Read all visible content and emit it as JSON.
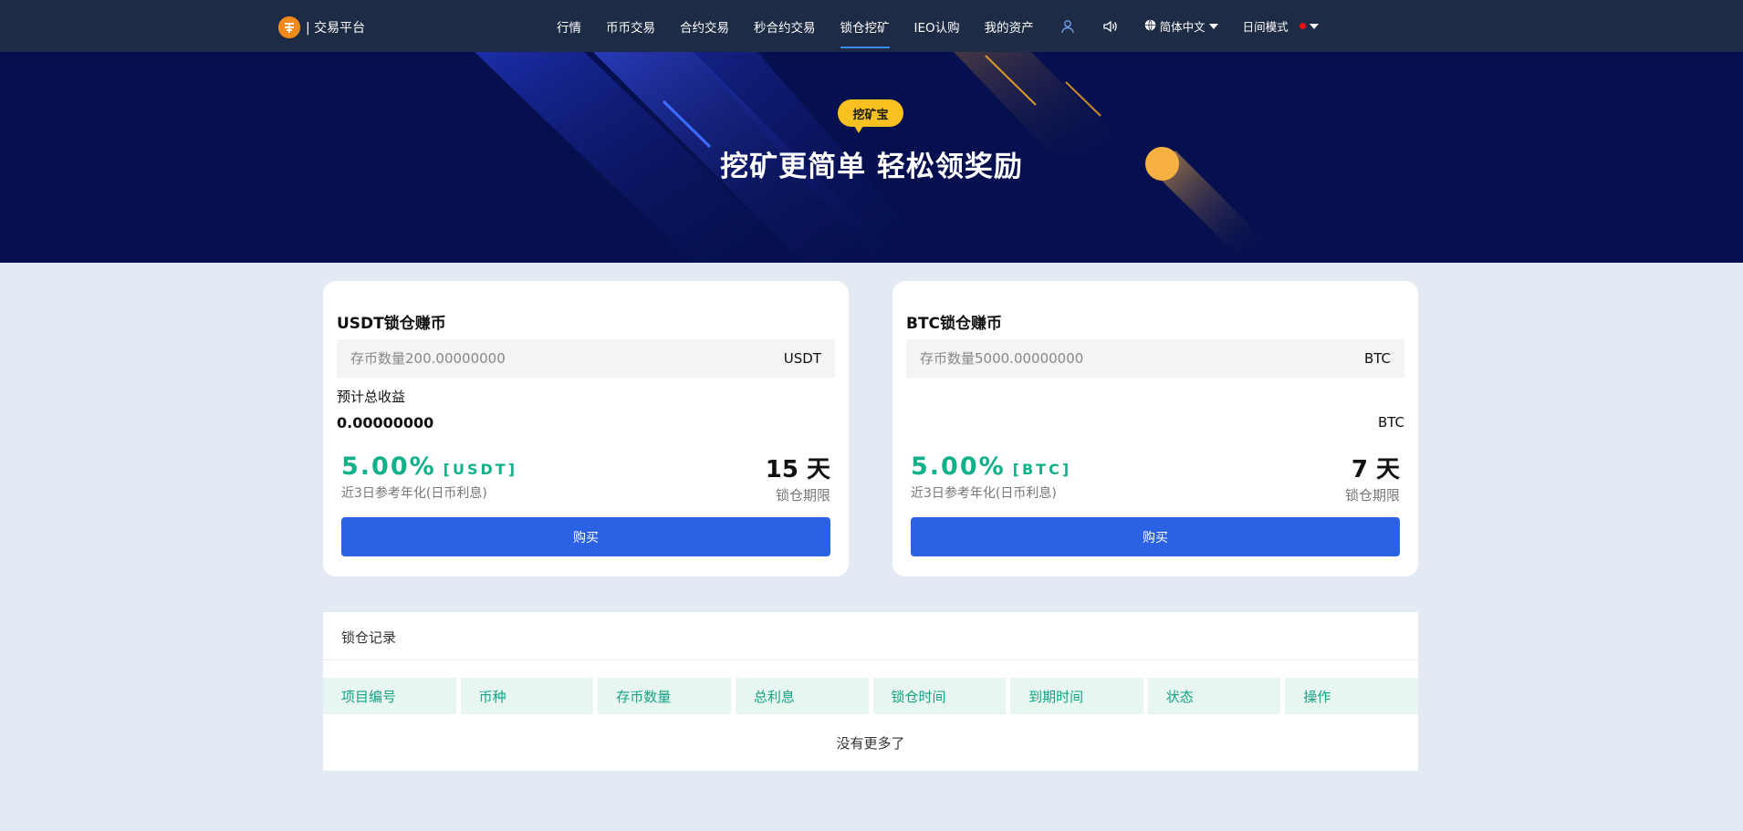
{
  "nav": {
    "brand_logo": "",
    "brand_text": "| 交易平台",
    "items": [
      {
        "label": "行情",
        "active": false
      },
      {
        "label": "币币交易",
        "active": false
      },
      {
        "label": "合约交易",
        "active": false
      },
      {
        "label": "秒合约交易",
        "active": false
      },
      {
        "label": "锁仓挖矿",
        "active": true
      },
      {
        "label": "IEO认购",
        "active": false
      },
      {
        "label": "我的资产",
        "active": false
      }
    ],
    "user_icon": "user-icon",
    "sound_icon": "speaker-icon",
    "language": "简体中文",
    "language_icon": "globe-icon",
    "mode": "日间模式"
  },
  "banner": {
    "tag": "挖矿宝",
    "headline": "挖矿更简单 轻松领奖励"
  },
  "cards": [
    {
      "title": "USDT锁仓赚币",
      "placeholder": "存币数量200.00000000",
      "unit": "USDT",
      "est_label": "预计总收益",
      "est_value": "0.00000000",
      "est_unit": "",
      "rate": "5.00%",
      "rate_unit": "[USDT]",
      "rate_note": "近3日参考年化(日币利息)",
      "days": "15 天",
      "days_note": "锁仓期限",
      "buy_label": "购买"
    },
    {
      "title": "BTC锁仓赚币",
      "placeholder": "存币数量5000.00000000",
      "unit": "BTC",
      "est_label": "",
      "est_value": "",
      "est_unit": "BTC",
      "rate": "5.00%",
      "rate_unit": "[BTC]",
      "rate_note": "近3日参考年化(日币利息)",
      "days": "7 天",
      "days_note": "锁仓期限",
      "buy_label": "购买"
    }
  ],
  "records": {
    "title": "锁仓记录",
    "columns": [
      "项目编号",
      "币种",
      "存币数量",
      "总利息",
      "锁仓时间",
      "到期时间",
      "状态",
      "操作"
    ],
    "empty_text": "没有更多了"
  },
  "colors": {
    "nav_bg": "#1e2b44",
    "banner_bg": "#06104f",
    "accent_green": "#13b18b",
    "button_blue": "#2b62e3",
    "tag_yellow": "#f7c221"
  }
}
